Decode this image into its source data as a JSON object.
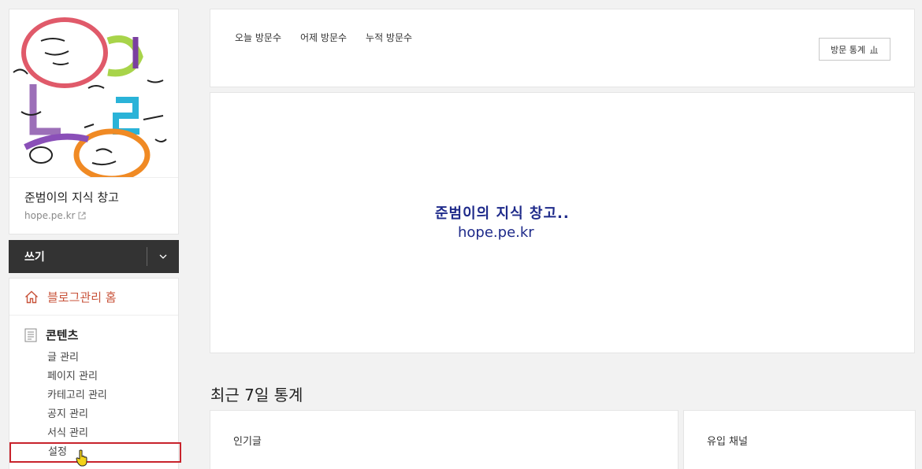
{
  "sidebar": {
    "blog_name": "준범이의 지식 창고",
    "blog_url": "hope.pe.kr",
    "write_label": "쓰기",
    "menu": {
      "home_label": "블로그관리 홈",
      "contents_label": "콘텐츠",
      "items": [
        "글 관리",
        "페이지 관리",
        "카테고리 관리",
        "공지 관리",
        "서식 관리",
        "설정"
      ]
    }
  },
  "stats": {
    "tabs": [
      "오늘 방문수",
      "어제 방문수",
      "누적 방문수"
    ],
    "button_label": "방문 통계"
  },
  "banner": {
    "line1": "준범이의 지식 창고..",
    "line2": "hope.pe.kr"
  },
  "recent": {
    "title": "최근 7일 통계",
    "popular_label": "인기글",
    "inflow_label": "유입 채널"
  },
  "colors": {
    "accent": "#c8533a",
    "highlight_box": "#c8232c",
    "write_bar": "#333333",
    "banner_text": "#1e2a8a"
  },
  "icons": [
    "image-icon",
    "external-link-icon",
    "chevron-down-icon",
    "home-icon",
    "document-icon",
    "bar-chart-icon",
    "hand-cursor-icon"
  ]
}
